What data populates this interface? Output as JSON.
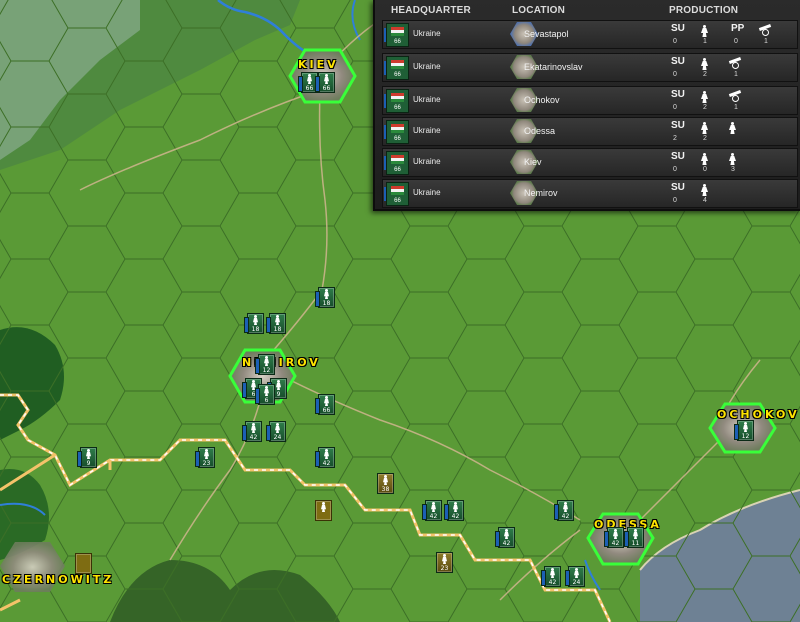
{
  "production_panel": {
    "headers": {
      "headquarter": "HEADQUARTER",
      "location": "LOCATION",
      "production": "PRODUCTION"
    },
    "rows": [
      {
        "hq_strength": "66",
        "nation": "Ukraine",
        "location": "Sevastapol",
        "su_label": "SU",
        "su": "0",
        "infantry": "1",
        "pp_label": "PP",
        "pp": "0",
        "artillery": "1"
      },
      {
        "hq_strength": "66",
        "nation": "Ukraine",
        "location": "Ekatarinovslav",
        "su_label": "SU",
        "su": "0",
        "infantry": "2",
        "artillery": "1"
      },
      {
        "hq_strength": "66",
        "nation": "Ukraine",
        "location": "Ochokov",
        "su_label": "SU",
        "su": "0",
        "infantry": "2",
        "artillery": "1"
      },
      {
        "hq_strength": "66",
        "nation": "Ukraine",
        "location": "Odessa",
        "su_label": "SU",
        "su": "2",
        "infantry": "2"
      },
      {
        "hq_strength": "66",
        "nation": "Ukraine",
        "location": "Kiev",
        "su_label": "SU",
        "su": "0",
        "infantry": "0",
        "infantry2": "3"
      },
      {
        "hq_strength": "66",
        "nation": "Ukraine",
        "location": "Nemirov",
        "su_label": "SU",
        "su": "0",
        "infantry": "4"
      }
    ]
  },
  "map": {
    "cities": {
      "kiev": "KIEV",
      "nemirov": "NEMIROV",
      "ochokov": "OCHOKOV",
      "odessa": "ODESSA",
      "czernowitz": "CZERNOWITZ"
    },
    "units": [
      {
        "id": "kiev-hq",
        "strength": "66"
      },
      {
        "id": "kiev-gar",
        "strength": "66"
      },
      {
        "id": "road-north",
        "strength": "18"
      },
      {
        "id": "west-1",
        "strength": "18"
      },
      {
        "id": "west-2",
        "strength": "18"
      },
      {
        "id": "nem-1",
        "strength": "12"
      },
      {
        "id": "nem-2",
        "strength": "6"
      },
      {
        "id": "nem-3",
        "strength": "9"
      },
      {
        "id": "nem-4",
        "strength": "6"
      },
      {
        "id": "nem-east",
        "strength": "66"
      },
      {
        "id": "s-1",
        "strength": "42"
      },
      {
        "id": "s-2",
        "strength": "24"
      },
      {
        "id": "s-3",
        "strength": "9"
      },
      {
        "id": "s-4",
        "strength": "23"
      },
      {
        "id": "s-5",
        "strength": "42"
      },
      {
        "id": "s-6",
        "strength": "38"
      },
      {
        "id": "s-7",
        "strength": "42"
      },
      {
        "id": "s-8",
        "strength": "42"
      },
      {
        "id": "s-9",
        "strength": "42"
      },
      {
        "id": "s-10",
        "strength": "42"
      },
      {
        "id": "s-11",
        "strength": "23"
      },
      {
        "id": "s-12",
        "strength": "42"
      },
      {
        "id": "s-13",
        "strength": "24"
      },
      {
        "id": "ode-1",
        "strength": "42"
      },
      {
        "id": "ode-2",
        "strength": "11"
      },
      {
        "id": "och-1",
        "strength": "12"
      }
    ]
  },
  "colors": {
    "grass": "#5a9a36",
    "sea": "#6e8194",
    "city_label": "#ffe400",
    "border": "#f4c36a",
    "hq_highlight": "#39ff39",
    "panel_bg": "#222222"
  }
}
